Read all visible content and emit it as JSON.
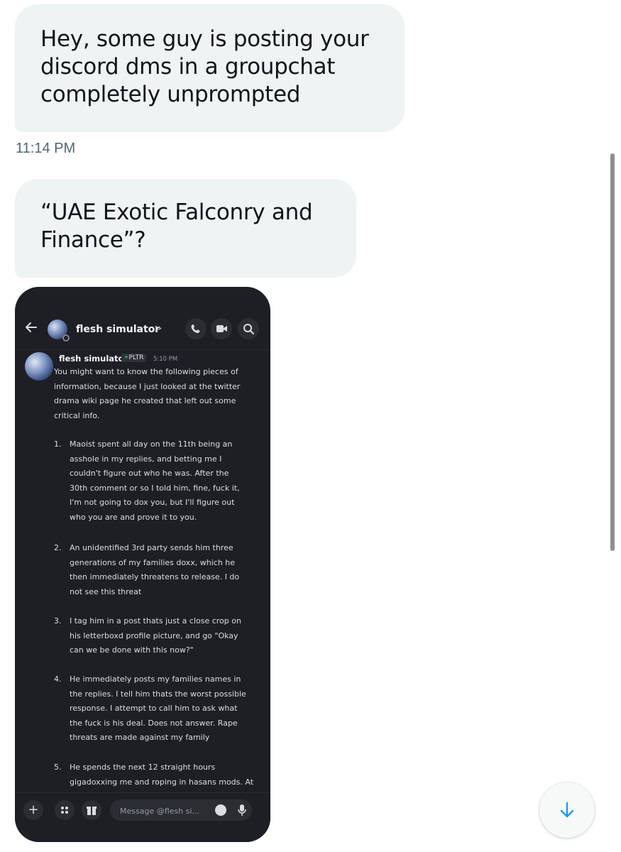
{
  "conversation": {
    "messages": [
      {
        "lines": [
          "Hey, some guy is posting your",
          "discord dms in a groupchat",
          "completely unprompted"
        ]
      },
      {
        "lines": [
          "“UAE Exotic Falconry and",
          "Finance”?"
        ]
      }
    ],
    "timestamp": "11:14 PM"
  },
  "embedded_image": {
    "header": {
      "channel_name": "flesh simulator",
      "chevron": ">"
    },
    "message": {
      "author": "flesh simulator",
      "tag": "PLTR",
      "time": "5:10 PM",
      "intro": [
        "You might want to know the following pieces of",
        "information, because I just looked at the twitter",
        "drama wiki page he created that left out some",
        "critical info."
      ],
      "items": [
        {
          "num": "1.",
          "lines": [
            "Maoist spent all day on the 11th being an",
            "asshole in my replies, and betting me I",
            "couldn't figure out who he was. After the",
            "30th comment or so I told him, fine, fuck it,",
            "I'm not going to dox you, but I'll figure out",
            "who you are and prove it to you."
          ]
        },
        {
          "num": "2.",
          "lines": [
            "An unidentified 3rd party sends him three",
            "generations of my families doxx, which he",
            "then immediately threatens to release. I do",
            "not see this threat"
          ]
        },
        {
          "num": "3.",
          "lines": [
            "I tag him in a post thats just a close crop on",
            "his letterboxd profile picture, and go \"Okay",
            "can we be done with this now?\""
          ]
        },
        {
          "num": "4.",
          "lines": [
            "He immediately posts my families names in",
            "the replies. I tell him thats the worst possible",
            "response. I attempt to call him to ask what",
            "the fuck is his deal. Does not answer. Rape",
            "threats are made against my family"
          ]
        },
        {
          "num": "5.",
          "lines": [
            "He spends the next 12 straight hours",
            "gigadoxxing me and roping in hasans mods. At"
          ]
        }
      ]
    },
    "composer": {
      "placeholder": "Message @flesh si..."
    }
  }
}
